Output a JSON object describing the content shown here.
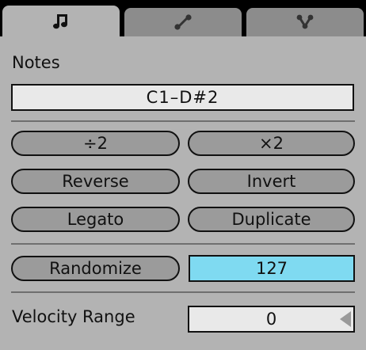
{
  "tabs": [
    {
      "icon": "music-note-icon",
      "active": true
    },
    {
      "icon": "line-segment-icon",
      "active": false
    },
    {
      "icon": "branch-icon",
      "active": false
    }
  ],
  "notes": {
    "title": "Notes",
    "range": "C1–D#2"
  },
  "buttons": {
    "divide": "÷2",
    "multiply": "×2",
    "reverse": "Reverse",
    "invert": "Invert",
    "legato": "Legato",
    "duplicate": "Duplicate",
    "randomize": "Randomize"
  },
  "randomize_value": "127",
  "velocity": {
    "label": "Velocity Range",
    "value": "0"
  },
  "colors": {
    "accent": "#7fdaf1",
    "panel": "#b3b3b3"
  }
}
